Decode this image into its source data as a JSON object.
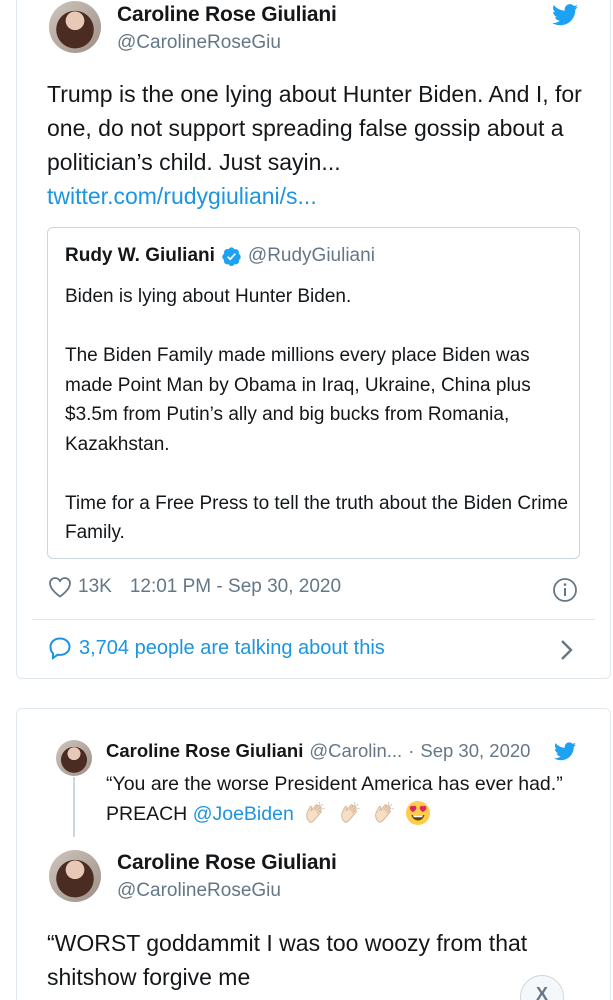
{
  "tweet": {
    "author_name": "Caroline Rose Giuliani",
    "author_handle": "@CarolineRoseGiu",
    "text": "Trump is the one lying about Hunter Biden. And I, for one, do not support spreading false gossip about a politician’s child. Just sayin...",
    "link": "twitter.com/rudygiuliani/s...",
    "likes": "13K",
    "timestamp": "12:01 PM - Sep 30, 2020",
    "conversation": "3,704 people are talking about this"
  },
  "quote": {
    "author_name": "Rudy W. Giuliani",
    "author_handle": "@RudyGiuliani",
    "paragraphs": [
      "Biden is lying about Hunter Biden.",
      "The Biden Family made millions every place Biden was made Point Man by Obama in Iraq, Ukraine, China plus $3.5m from Putin’s ally and big bucks from Romania, Kazakhstan.",
      "Time for a Free Press to tell the truth about the Biden Crime Family."
    ]
  },
  "reply_parent": {
    "author_name": "Caroline Rose Giuliani",
    "author_handle": "@Carolin...",
    "separator": "·",
    "date": "Sep 30, 2020",
    "text_before": "“You are the worse President America has ever had.” PREACH ",
    "mention": "@JoeBiden",
    "emojis": [
      "clapping-hands-light",
      "clapping-hands-light",
      "clapping-hands-light",
      "heart-eyes-face"
    ]
  },
  "tweet2": {
    "author_name": "Caroline Rose Giuliani",
    "author_handle": "@CarolineRoseGiu",
    "text": "“WORST goddammit I was too woozy from that shitshow forgive me"
  },
  "close_label": "X",
  "colors": {
    "twitter_blue": "#1da1f2",
    "link_blue": "#1b95e0",
    "secondary_text": "#657786",
    "border": "#e1e8ed",
    "heart_eyes_red": "#e0245e"
  }
}
